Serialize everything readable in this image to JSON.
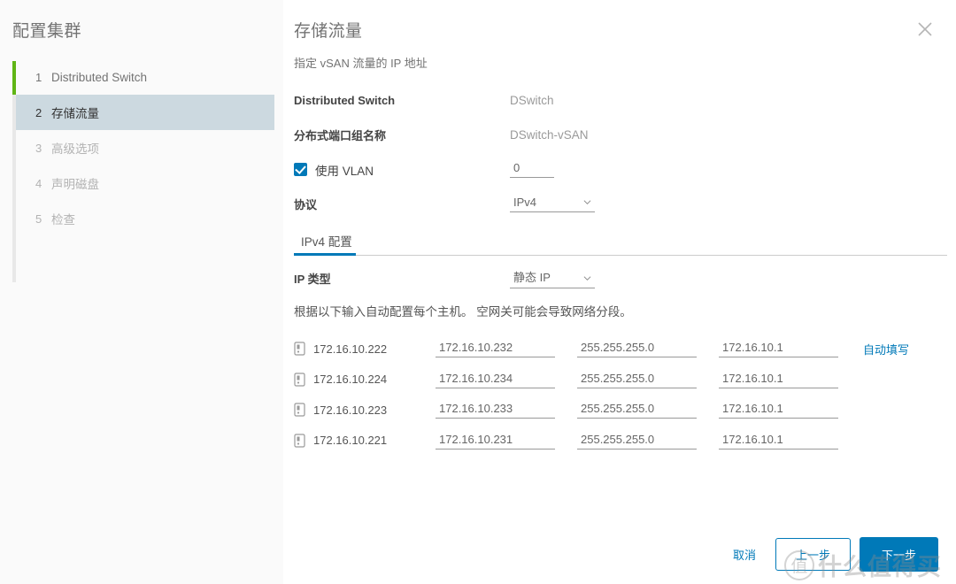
{
  "sidebar": {
    "title": "配置集群",
    "items": [
      {
        "num": "1",
        "label": "Distributed Switch",
        "state": "done"
      },
      {
        "num": "2",
        "label": "存储流量",
        "state": "active"
      },
      {
        "num": "3",
        "label": "高级选项",
        "state": "disabled"
      },
      {
        "num": "4",
        "label": "声明磁盘",
        "state": "disabled"
      },
      {
        "num": "5",
        "label": "检查",
        "state": "disabled"
      }
    ]
  },
  "main": {
    "title": "存储流量",
    "subtitle": "指定 vSAN 流量的 IP 地址",
    "close_icon": "close-icon",
    "fields": {
      "dswitch_label": "Distributed Switch",
      "dswitch_value": "DSwitch",
      "portgroup_label": "分布式端口组名称",
      "portgroup_value": "DSwitch-vSAN",
      "vlan_label": "使用 VLAN",
      "vlan_value": "0",
      "protocol_label": "协议",
      "protocol_value": "IPv4"
    },
    "tab": {
      "label": "IPv4 配置"
    },
    "ip_type": {
      "label": "IP 类型",
      "value": "静态 IP"
    },
    "hint": "根据以下输入自动配置每个主机。 空网关可能会导致网络分段。",
    "autofill_label": "自动填写",
    "table": {
      "rows": [
        {
          "host": "172.16.10.222",
          "ip": "172.16.10.232",
          "mask": "255.255.255.0",
          "gateway": "172.16.10.1"
        },
        {
          "host": "172.16.10.224",
          "ip": "172.16.10.234",
          "mask": "255.255.255.0",
          "gateway": "172.16.10.1"
        },
        {
          "host": "172.16.10.223",
          "ip": "172.16.10.233",
          "mask": "255.255.255.0",
          "gateway": "172.16.10.1"
        },
        {
          "host": "172.16.10.221",
          "ip": "172.16.10.231",
          "mask": "255.255.255.0",
          "gateway": "172.16.10.1"
        }
      ]
    }
  },
  "footer": {
    "cancel": "取消",
    "back": "上一步",
    "next": "下一步"
  },
  "watermark": {
    "mark": "值",
    "text": "什么值得买"
  },
  "colors": {
    "accent": "#0079b8",
    "done": "#60b515",
    "active_bg": "#ccd9e0"
  }
}
